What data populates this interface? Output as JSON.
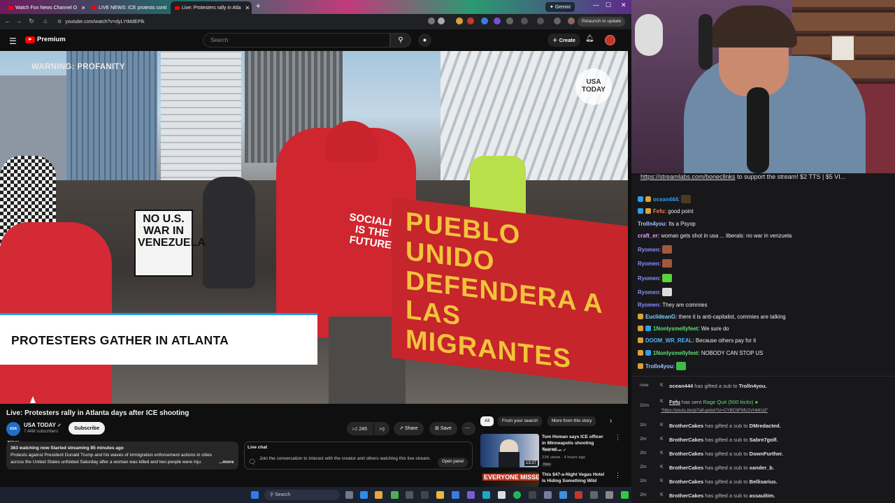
{
  "browser": {
    "tabs": [
      {
        "title": "Watch Fox News Channel O",
        "active": false
      },
      {
        "title": "LIVE NEWS: ICE protests conti",
        "active": false
      },
      {
        "title": "Live: Protesters rally in Atla",
        "active": true
      }
    ],
    "gemini_label": "Gemini",
    "url": "youtube.com/watch?v=dyLYtMdEPlk",
    "relaunch_label": "Relaunch to update"
  },
  "youtube": {
    "logo_text": "Premium",
    "search_placeholder": "Search",
    "create_label": "Create"
  },
  "video": {
    "warning_text": "WARNING: PROFANITY",
    "watermark": "USA TODAY",
    "lower_third": "PROTESTERS GATHER IN ATLANTA",
    "signs": [
      "NO U.S. WAR IN VENEZUELA",
      "SOCIALISM IS THE FUTURE",
      "PUEBLO UNIDO DEFENDERA A LAS MIGRANTES"
    ],
    "title": "Live: Protesters rally in Atlanta days after ICE shooting",
    "channel": "USA TODAY",
    "channel_logo": "USA TODAY",
    "subscribers": "7.44M subscribers",
    "subscribe_label": "Subscribe",
    "likes": "245",
    "share_label": "Share",
    "save_label": "Save",
    "description_stats": "363 watching now  Started streaming 85 minutes ago",
    "description": "Protests against President Donald Trump and his waves of immigration enforcement actions in cities across the United States unfolded Saturday after a woman was killed and two people were inju",
    "more_label": "...more"
  },
  "live_chat": {
    "label": "Live chat",
    "join_text": "Join the conversation to interact with the creator and others watching this live stream.",
    "open_panel": "Open panel"
  },
  "chips": [
    "All",
    "From your search",
    "More from this story"
  ],
  "recommendations": [
    {
      "title": "Tom Homan says ICE officer in Minneapolis shooting 'feared ...",
      "channel": "NBC News",
      "meta": "22K views · 4 hours ago",
      "badge": "New",
      "duration": "13:27"
    },
    {
      "title": "This $47-a-Night Vegas Hotel Is Hiding Something Wild",
      "thumb_text": "EVERYONE MISSES IT"
    }
  ],
  "taskbar": {
    "search_label": "Search"
  },
  "stream_chat": {
    "banner_link": "https://streamlabs.com/bonecllnks",
    "banner_text": " to support the stream! $2 TTS | $5 VI...",
    "messages": [
      {
        "user": "ocean444:",
        "text": "",
        "color": "#2f9ee8",
        "emote": "#4a3a20"
      },
      {
        "user": "Fefu:",
        "text": "good point",
        "color": "#ff7a4a"
      },
      {
        "user": "Trolln4you:",
        "text": "Its a Psyop",
        "color": "#9ec3ff"
      },
      {
        "user": "craft_er:",
        "text": "woman gets shot in usa ... liberals: no war in venzuela",
        "color": "#e6a2ff"
      },
      {
        "user": "Ryomen:",
        "text": "",
        "color": "#8a8fff",
        "emote": "#a05a3a"
      },
      {
        "user": "Ryomen:",
        "text": "",
        "color": "#8a8fff",
        "emote": "#a05a3a"
      },
      {
        "user": "Ryomen:",
        "text": "",
        "color": "#8a8fff",
        "emote": "#5bd13a"
      },
      {
        "user": "Ryomen:",
        "text": "",
        "color": "#8a8fff",
        "emote": "#dddddd"
      },
      {
        "user": "Ryomen:",
        "text": "They are commies",
        "color": "#8a8fff"
      },
      {
        "user": "EuclideanG:",
        "text": "there it is anti-capitalist, commies are talking",
        "color": "#7ad6ff"
      },
      {
        "user": "1Nonlysmellyfeet:",
        "text": "We sure do",
        "color": "#5ee07a"
      },
      {
        "user": "DOOM_WR_REAL:",
        "text": "Because others pay for it",
        "color": "#4fb6ff"
      },
      {
        "user": "1Nonlysmellyfeet:",
        "text": "NOBODY CAN STOP US",
        "color": "#5ee07a"
      },
      {
        "user": "Trolln4you:",
        "text": "",
        "color": "#9ec3ff",
        "emote": "#3dbb4a"
      }
    ],
    "events": [
      {
        "time": "now",
        "user": "ocean444",
        "text": " has gifted a sub to ",
        "target": "Trolln4you."
      },
      {
        "time": "32m",
        "user": "Fefu",
        "text": " has sent ",
        "target": "Rage Quit (500 kicks)",
        "link": "\"https://youtu.be/gi7a8-goluk?si=OYBO9FMU1Vr4drUd\""
      },
      {
        "time": "2hr",
        "user": "BrotherCakes",
        "text": " has gifted a sub to ",
        "target": "DMredacted."
      },
      {
        "time": "2hr",
        "user": "BrotherCakes",
        "text": " has gifted a sub to ",
        "target": "Sabre7golf."
      },
      {
        "time": "2hr",
        "user": "BrotherCakes",
        "text": " has gifted a sub to ",
        "target": "DownFurther."
      },
      {
        "time": "2hr",
        "user": "BrotherCakes",
        "text": " has gifted a sub to ",
        "target": "xander_b."
      },
      {
        "time": "2hr",
        "user": "BrotherCakes",
        "text": " has gifted a sub to ",
        "target": "Bellisarius."
      },
      {
        "time": "2hr",
        "user": "BrotherCakes",
        "text": " has gifted a sub to ",
        "target": "assaultim."
      }
    ]
  }
}
